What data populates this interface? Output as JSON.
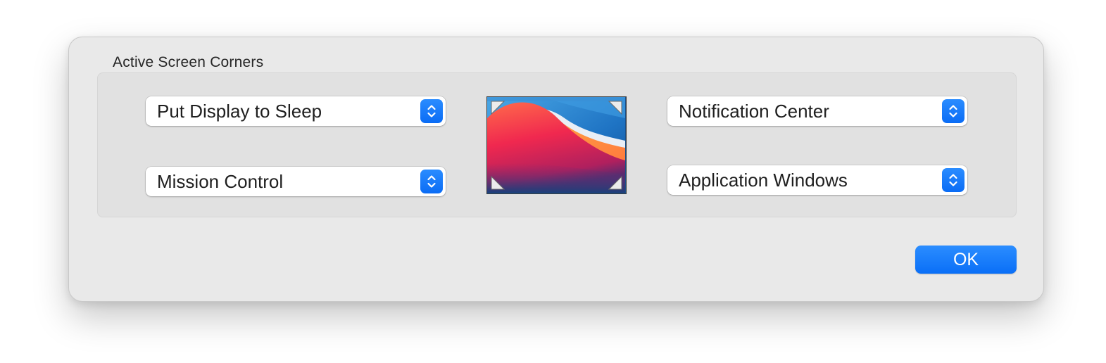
{
  "dialog": {
    "group_title": "Active Screen Corners",
    "corners": {
      "top_left": "Put Display to Sleep",
      "bottom_left": "Mission Control",
      "top_right": "Notification Center",
      "bottom_right": "Application Windows"
    },
    "ok_label": "OK"
  },
  "icons": {
    "stepper": "chevron-up-down-icon",
    "corner_markers": "corner-triangle-icon"
  },
  "colors": {
    "accent": "#0a6ff7",
    "sheet_background": "#e9e9e9",
    "group_background": "#e1e1e1"
  }
}
